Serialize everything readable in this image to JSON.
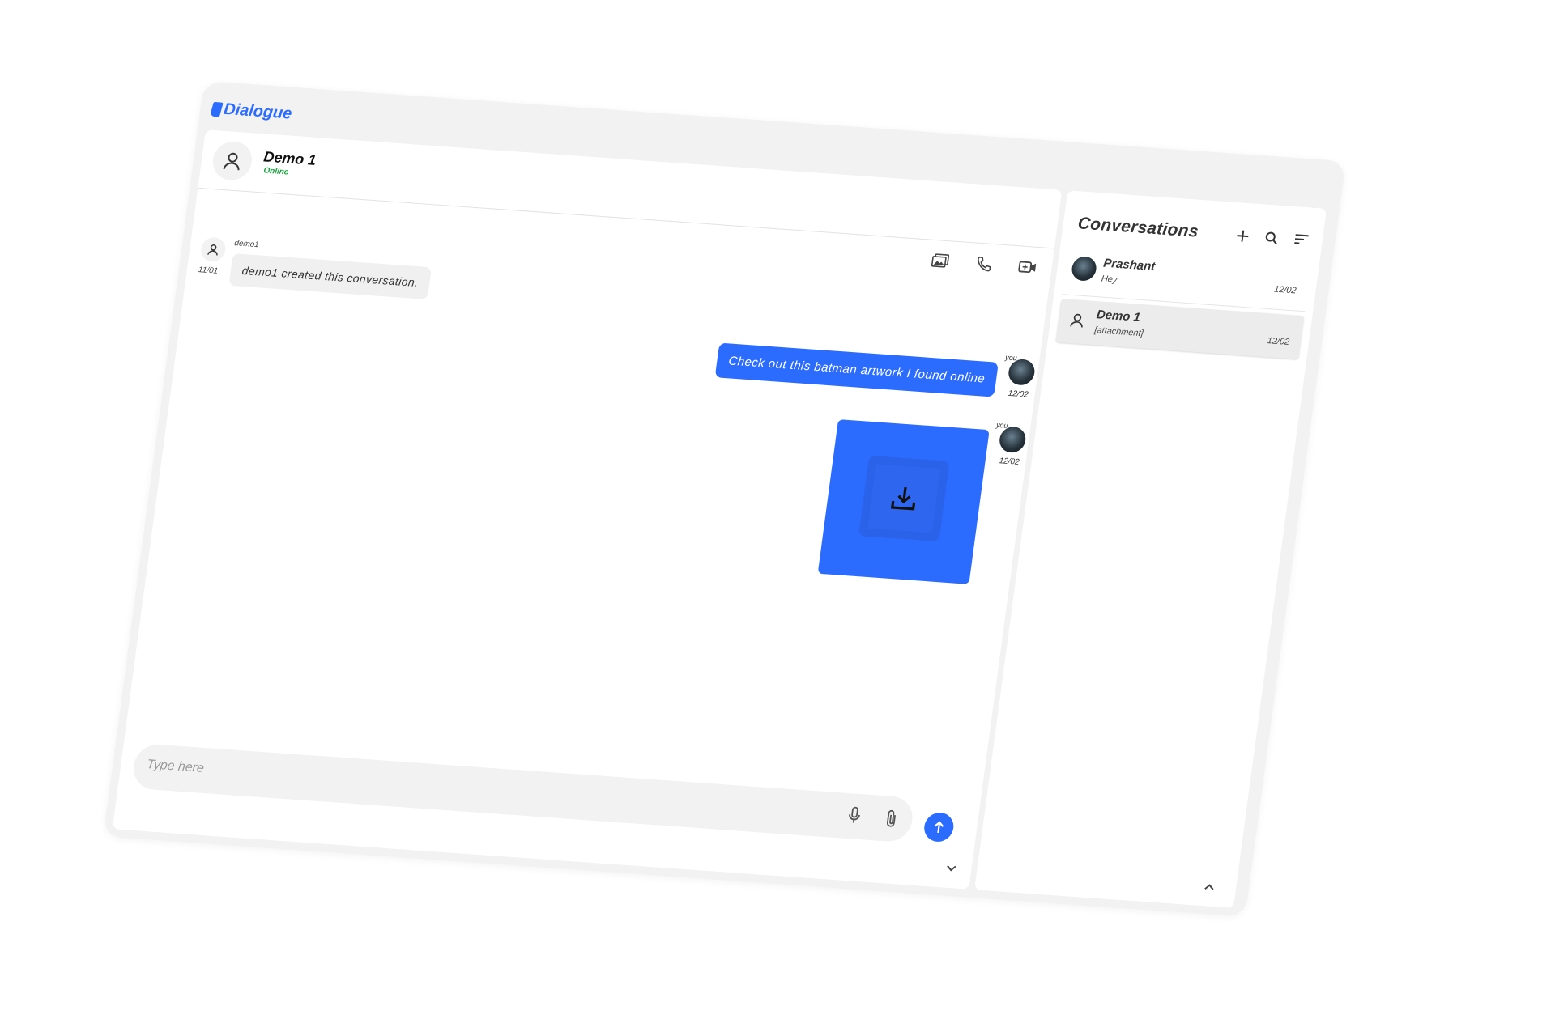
{
  "app": {
    "title": "Dialogue"
  },
  "toolbar": {
    "icons": [
      "chat-bubbles-icon",
      "moon-icon",
      "bell-icon",
      "sliders-icon",
      "user-avatar-icon"
    ]
  },
  "chat": {
    "contact": {
      "name": "Demo 1",
      "status": "Online"
    },
    "actions": [
      "gallery-icon",
      "phone-icon",
      "video-icon"
    ],
    "messages": [
      {
        "type": "system",
        "sender": "demo1",
        "time": "11/01",
        "text": "demo1 created this conversation."
      },
      {
        "type": "outgoing",
        "sender": "you",
        "time": "12/02",
        "text": "Check out this batman artwork I found online"
      },
      {
        "type": "outgoing-attachment",
        "sender": "you",
        "time": "12/02"
      }
    ],
    "composer": {
      "placeholder": "Type here"
    }
  },
  "conversations": {
    "title": "Conversations",
    "items": [
      {
        "name": "Prashant",
        "preview": "Hey",
        "time": "12/02"
      },
      {
        "name": "Demo 1",
        "preview": "[attachment]",
        "time": "12/02"
      }
    ]
  },
  "colors": {
    "accent": "#2b6cff",
    "online": "#1aa33e",
    "panel_bg": "#f2f2f2"
  }
}
